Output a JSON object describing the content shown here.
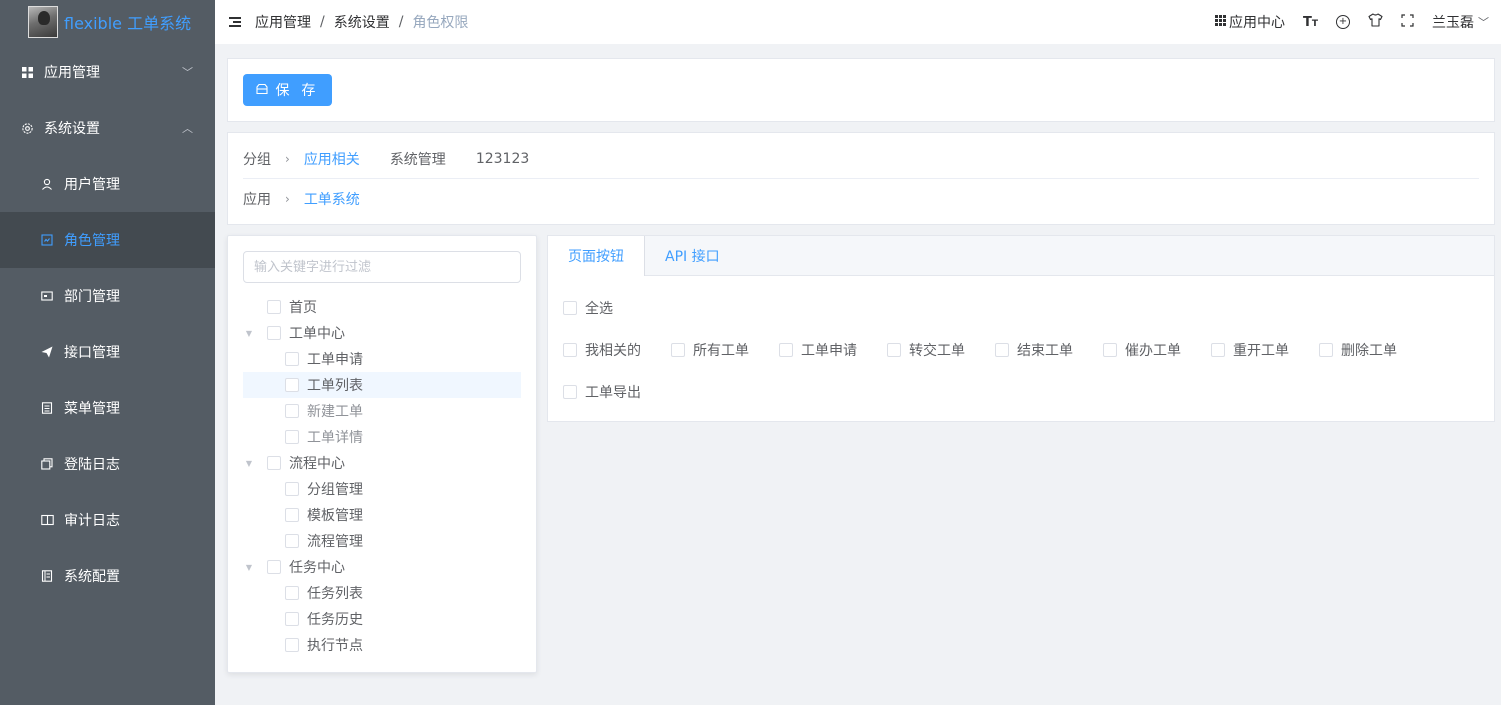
{
  "app": {
    "title": "flexible 工单系统"
  },
  "sidebar": {
    "groups": [
      {
        "label": "应用管理",
        "icon": "grid-icon",
        "arrow": "﹀"
      },
      {
        "label": "系统设置",
        "icon": "gear-icon",
        "arrow": "︿"
      }
    ],
    "items": [
      {
        "label": "用户管理",
        "icon": "user-icon"
      },
      {
        "label": "角色管理",
        "icon": "role-icon"
      },
      {
        "label": "部门管理",
        "icon": "department-icon"
      },
      {
        "label": "接口管理",
        "icon": "send-icon"
      },
      {
        "label": "菜单管理",
        "icon": "document-icon"
      },
      {
        "label": "登陆日志",
        "icon": "copy-icon"
      },
      {
        "label": "审计日志",
        "icon": "book-icon"
      },
      {
        "label": "系统配置",
        "icon": "list-icon"
      }
    ],
    "active_index": 1
  },
  "header": {
    "breadcrumb": [
      "应用管理",
      "系统设置",
      "角色权限"
    ],
    "separator": "/",
    "app_center": "应用中心",
    "user": "兰玉磊",
    "user_caret": "﹀"
  },
  "toolbar": {
    "save_label": "保 存"
  },
  "filter": {
    "group_label": "分组",
    "group_options": [
      "应用相关",
      "系统管理",
      "123123"
    ],
    "app_label": "应用",
    "app_options": [
      "工单系统"
    ],
    "chevron": "›"
  },
  "tree": {
    "placeholder": "输入关键字进行过滤",
    "caret": "▼",
    "nodes": [
      {
        "label": "首页"
      },
      {
        "label": "工单中心",
        "children": [
          "工单申请",
          "工单列表",
          "新建工单",
          "工单详情"
        ]
      },
      {
        "label": "流程中心",
        "children": [
          "分组管理",
          "模板管理",
          "流程管理"
        ]
      },
      {
        "label": "任务中心",
        "children": [
          "任务列表",
          "任务历史",
          "执行节点"
        ]
      }
    ]
  },
  "perm_tabs": [
    "页面按钮",
    "API 接口"
  ],
  "perms": {
    "select_all": "全选",
    "row1": [
      "我相关的",
      "所有工单",
      "工单申请",
      "转交工单",
      "结束工单",
      "催办工单",
      "重开工单",
      "删除工单"
    ],
    "row2": [
      "工单导出"
    ]
  },
  "colors": {
    "accent": "#409eff",
    "sidebar_bg": "#545c64",
    "sidebar_active_bg": "#434a50"
  }
}
